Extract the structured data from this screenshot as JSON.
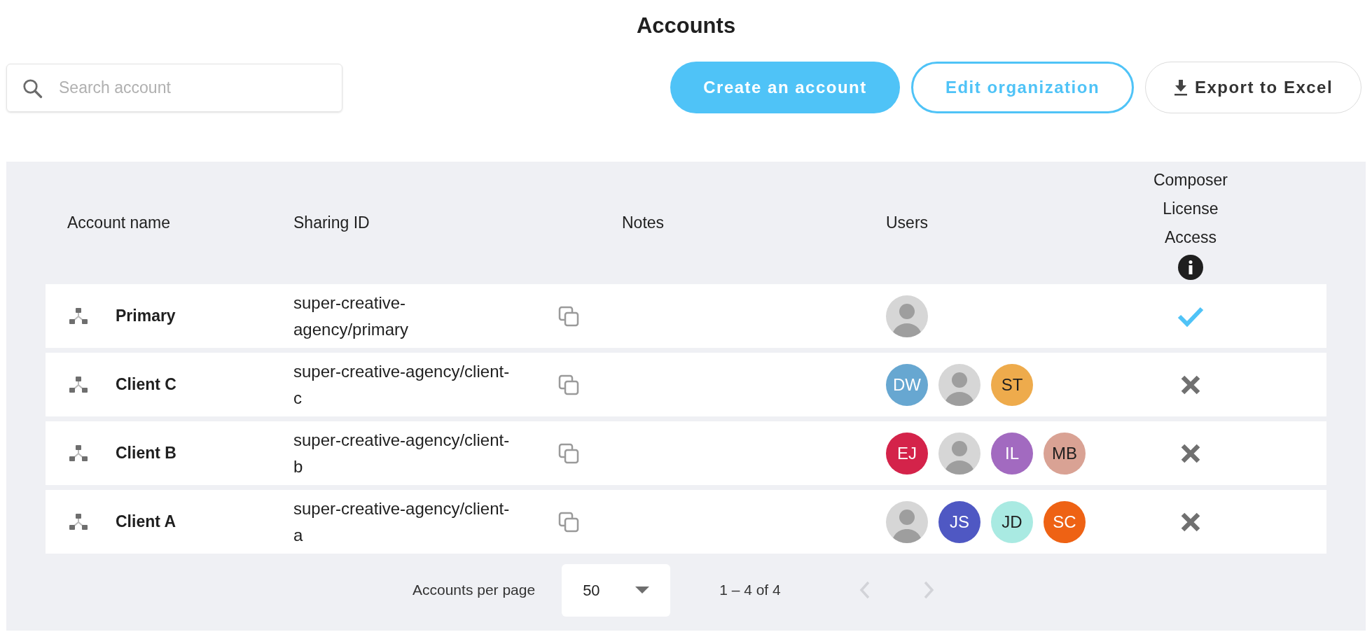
{
  "title": "Accounts",
  "search": {
    "placeholder": "Search account"
  },
  "actions": [
    {
      "label": "Create an account",
      "kind": "primary"
    },
    {
      "label": "Edit organization",
      "kind": "outline"
    },
    {
      "label": "Export to Excel",
      "kind": "export"
    }
  ],
  "table": {
    "columns": [
      "Account name",
      "Sharing ID",
      "Notes",
      "Users",
      "Composer License Access"
    ],
    "rows": [
      {
        "name": "Primary",
        "sharing_id": "super-creative-agency/primary",
        "users": [
          {
            "kind": "photo"
          }
        ],
        "composer_access": true
      },
      {
        "name": "Client C",
        "sharing_id": "super-creative-agency/client-c",
        "users": [
          {
            "kind": "initials",
            "initials": "DW",
            "color": "#67a7d1"
          },
          {
            "kind": "photo"
          },
          {
            "kind": "initials",
            "initials": "ST",
            "color": "#eeab4c"
          }
        ],
        "composer_access": false
      },
      {
        "name": "Client B",
        "sharing_id": "super-creative-agency/client-b",
        "users": [
          {
            "kind": "initials",
            "initials": "EJ",
            "color": "#d4234a"
          },
          {
            "kind": "photo"
          },
          {
            "kind": "initials",
            "initials": "IL",
            "color": "#a26ac0"
          },
          {
            "kind": "initials",
            "initials": "MB",
            "color": "#d9a294"
          }
        ],
        "composer_access": false
      },
      {
        "name": "Client A",
        "sharing_id": "super-creative-agency/client-a",
        "users": [
          {
            "kind": "photo"
          },
          {
            "kind": "initials",
            "initials": "JS",
            "color": "#4f58c3"
          },
          {
            "kind": "initials",
            "initials": "JD",
            "color": "#a9eae2"
          },
          {
            "kind": "initials",
            "initials": "SC",
            "color": "#ee6214"
          }
        ],
        "composer_access": false
      }
    ]
  },
  "pagination": {
    "label": "Accounts per page",
    "per_page": "50",
    "range": "1 – 4 of 4",
    "prev_disabled": true,
    "next_disabled": true
  }
}
